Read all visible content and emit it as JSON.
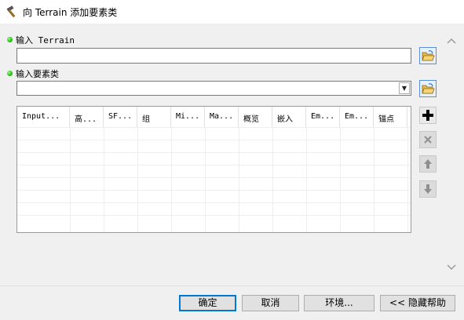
{
  "window": {
    "title": "向 Terrain 添加要素类",
    "icon": "hammer-icon"
  },
  "input_terrain": {
    "label": "输入 Terrain",
    "value": ""
  },
  "input_feature_class": {
    "label": "输入要素类",
    "value": ""
  },
  "table": {
    "columns": [
      "Input...",
      "高...",
      "SF...",
      "组",
      "Mi...",
      "Ma...",
      "概览",
      "嵌入",
      "Em...",
      "Em...",
      "锚点"
    ],
    "rows": []
  },
  "buttons": {
    "ok": "确定",
    "cancel": "取消",
    "environments": "环境...",
    "hide_help": "<< 隐藏帮助"
  },
  "colors": {
    "required_dot": "#15b000",
    "accent": "#0078d7"
  }
}
